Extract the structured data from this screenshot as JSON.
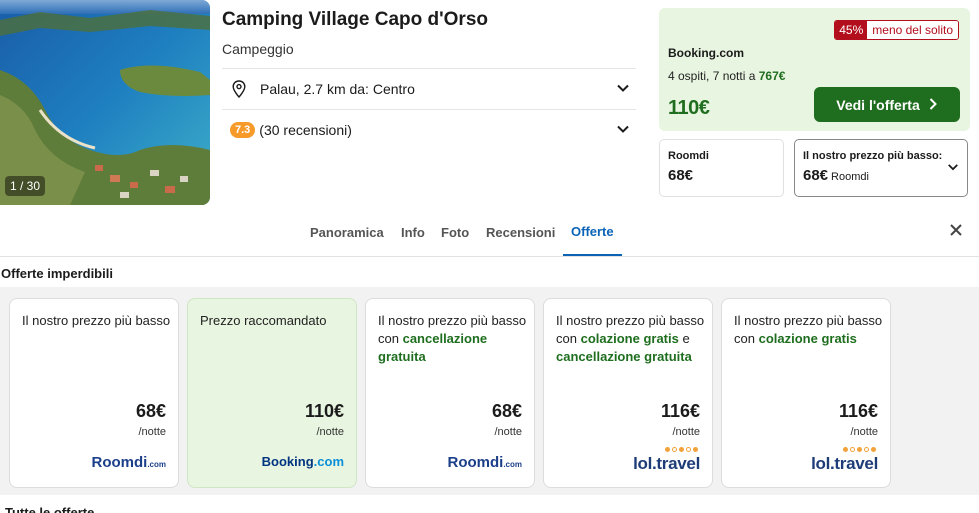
{
  "gallery": {
    "counter": "1 / 30"
  },
  "hotel": {
    "name": "Camping Village Capo d'Orso",
    "type": "Campeggio",
    "location": "Palau, 2.7 km da: Centro",
    "rating": "7.3",
    "reviews": "(30 recensioni)"
  },
  "deal": {
    "discount_pct": "45%",
    "discount_text": "meno del solito",
    "provider": "Booking.com",
    "stay_prefix": "4 ospiti, 7 notti a",
    "stay_total": "767€",
    "price": "110€",
    "cta_label": "Vedi l'offerta"
  },
  "alt_prices": {
    "first": {
      "label": "Roomdi",
      "price": "68€"
    },
    "lowest": {
      "label": "Il nostro prezzo più basso:",
      "price": "68€",
      "provider": "Roomdi"
    }
  },
  "tabs": [
    {
      "label": "Panoramica"
    },
    {
      "label": "Info"
    },
    {
      "label": "Foto"
    },
    {
      "label": "Recensioni"
    },
    {
      "label": "Offerte"
    }
  ],
  "section_title": "Offerte imperdibili",
  "offers": [
    {
      "title_plain": "Il nostro prezzo più basso",
      "price": "68€",
      "unit": "/notte",
      "logo_main": "Roomdi",
      "logo_dom": ".com"
    },
    {
      "title_plain": "Prezzo raccomandato",
      "price": "110€",
      "unit": "/notte",
      "logo_main": "Booking",
      "logo_dom": ".com"
    },
    {
      "title_plain": "Il nostro prezzo più basso con",
      "title_green": "cancellazione gratuita",
      "price": "68€",
      "unit": "/notte",
      "logo_main": "Roomdi",
      "logo_dom": ".com"
    },
    {
      "title_plain": "Il nostro prezzo più basso con",
      "title_green": "colazione gratis",
      "title_and": "e",
      "title_green2": "cancellazione gratuita",
      "price": "116€",
      "unit": "/notte",
      "logo_main": "lol.travel"
    },
    {
      "title_plain": "Il nostro prezzo più basso con",
      "title_green": "colazione gratis",
      "price": "116€",
      "unit": "/notte",
      "logo_main": "lol.travel"
    }
  ],
  "bottom_title": "Tutte le offerte",
  "colors": {
    "accent_green": "#1f6e1f",
    "accent_blue": "#0b63b6",
    "discount_red": "#b30e1c",
    "rating_orange": "#f79a2a"
  },
  "icons": [
    "map-pin-icon",
    "chevron-down-icon",
    "chevron-right-icon",
    "close-icon"
  ]
}
